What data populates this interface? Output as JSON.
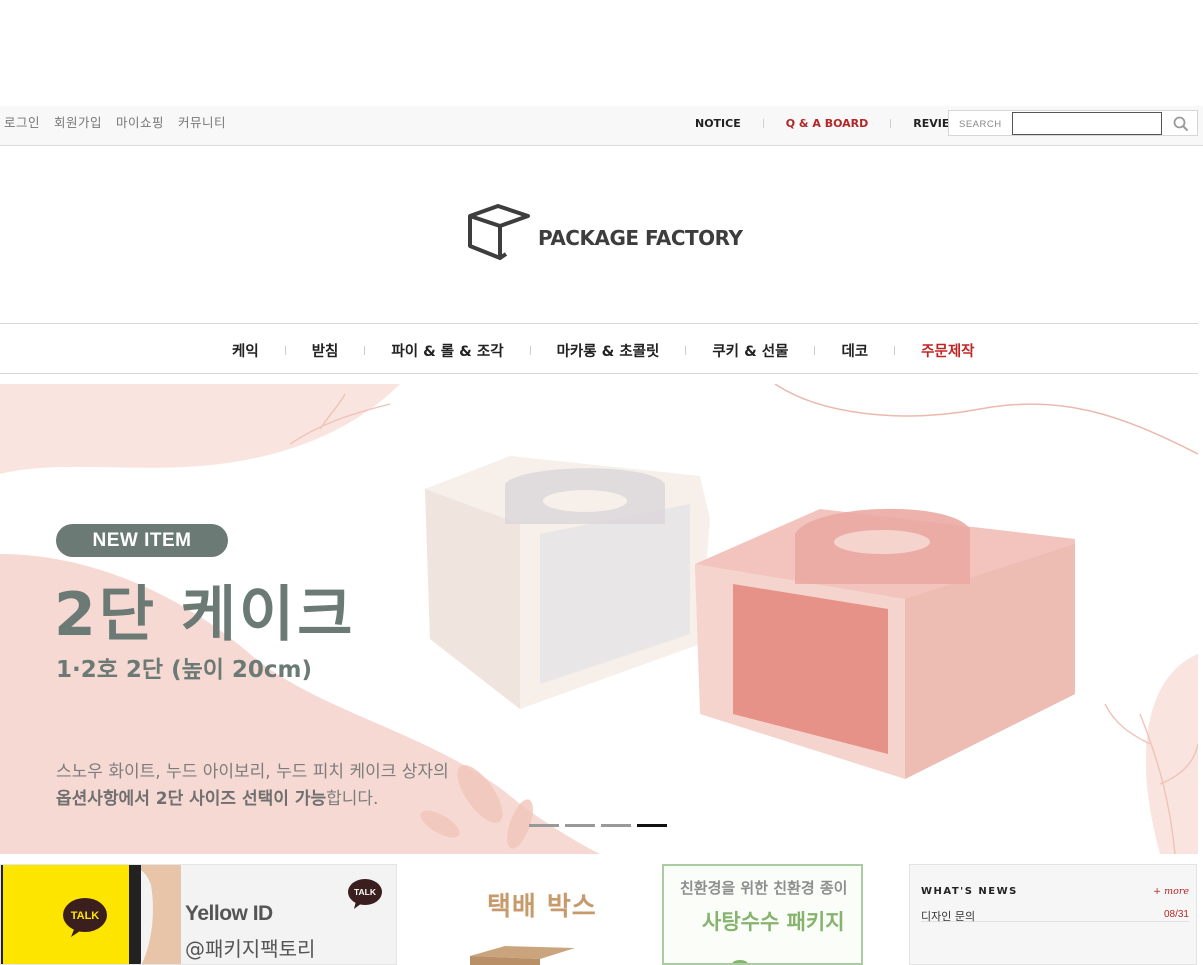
{
  "top_utility": {
    "login": "로그인",
    "join": "회원가입",
    "myshop": "마이쇼핑",
    "community": "커뮤니티"
  },
  "board_nav": {
    "notice": "NOTICE",
    "qa": "Q & A BOARD",
    "review": "REVIEW"
  },
  "search": {
    "label": "SEARCH",
    "value": "",
    "placeholder": ""
  },
  "logo": {
    "text": "PACKAGE FACTORY"
  },
  "category_nav": [
    {
      "label": "케익"
    },
    {
      "label": "받침"
    },
    {
      "label": "파이 & 롤 & 조각"
    },
    {
      "label": "마카롱 & 초콜릿"
    },
    {
      "label": "쿠키 & 선물"
    },
    {
      "label": "데코"
    },
    {
      "label": "주문제작"
    }
  ],
  "banner": {
    "badge": "NEW ITEM",
    "title": "2단 케이크",
    "subtitle": "1·2호 2단 (높이 20cm)",
    "desc_line1": "스노우 화이트, 누드 아이보리, 누드 피치 케이크 상자의",
    "desc_line2_bold": "옵션사항에서 2단 사이즈 선택이 가능",
    "desc_line2_rest": "합니다.",
    "slides": 4,
    "active_slide": 4
  },
  "promos": {
    "kakao_badge": "TALK",
    "kakao_badge_small": "TALK",
    "kakao_title": "Yellow ID",
    "kakao_handle": "@패키지팩토리",
    "box_title": "택배 박스",
    "eco_line1": "친환경을 위한 친환경 종이",
    "eco_line2": "사탕수수 패키지"
  },
  "news": {
    "title": "WHAT'S NEWS",
    "more": "+ more",
    "items": [
      {
        "title": "디자인 문의",
        "date": "08/31"
      }
    ]
  },
  "colors": {
    "accent_red": "#b32626",
    "banner_text": "#6b7a74",
    "banner_pink": "#f7d9d3",
    "eco_green": "#86b36e"
  }
}
